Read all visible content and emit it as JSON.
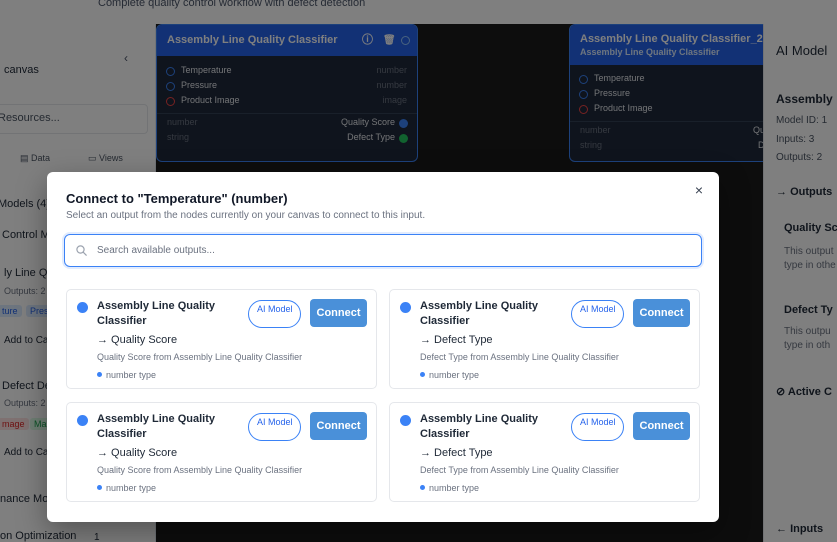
{
  "header": {
    "subtitle": "Complete quality control workflow with defect detection"
  },
  "sidebar": {
    "canvas_label": "canvas",
    "resources_placeholder": "Resources...",
    "tabs": [
      "Data",
      "Views"
    ],
    "section_models": "Models (4)",
    "items": [
      {
        "title": "Control M"
      },
      {
        "title": "ly Line Qu",
        "meta": "Outputs: 2",
        "tags": [
          "ture",
          "Pres"
        ],
        "add": "Add to Ca"
      },
      {
        "title": "Defect De",
        "meta": "Outputs: 2",
        "tags": [
          "mage",
          "Ma"
        ],
        "add": "Add to Ca"
      },
      {
        "title": "nance Mo"
      },
      {
        "title": "on Optimization",
        "count": "1"
      }
    ]
  },
  "nodes": [
    {
      "title": "Assembly Line Quality Classifier",
      "inputs": [
        {
          "label": "Temperature",
          "type": "number"
        },
        {
          "label": "Pressure",
          "type": "number"
        },
        {
          "label": "Product Image",
          "type": "image"
        }
      ],
      "outputs": [
        {
          "type": "number",
          "label": "Quality Score",
          "color": "#3b82f6"
        },
        {
          "type": "string",
          "label": "Defect Type",
          "color": "#22c55e"
        }
      ]
    },
    {
      "title": "Assembly Line Quality Classifier_2",
      "subtitle": "Assembly Line Quality Classifier",
      "inputs": [
        {
          "label": "Temperature"
        },
        {
          "label": "Pressure"
        },
        {
          "label": "Product Image"
        }
      ],
      "outputs": [
        {
          "type": "number",
          "label": "Qu"
        },
        {
          "type": "string",
          "label": "D"
        }
      ]
    }
  ],
  "right_panel": {
    "title": "AI Model",
    "name": "Assembly",
    "model_id": "Model ID: 1",
    "inputs": "Inputs: 3",
    "outputs": "Outputs: 2",
    "outputs_section": "Outputs",
    "out1_title": "Quality Sc",
    "out1_desc1": "This output",
    "out1_desc2": "type in othe",
    "out2_title": "Defect Ty",
    "out2_desc1": "This outpu",
    "out2_desc2": "type in oth",
    "active_section": "Active C",
    "inputs_section": "Inputs"
  },
  "modal": {
    "title": "Connect to \"Temperature\" (number)",
    "description": "Select an output from the nodes currently on your canvas to connect to this input.",
    "close": "×",
    "search_placeholder": "Search available outputs...",
    "cards": [
      {
        "node": "Assembly Line Quality Classifier",
        "badge": "AI Model",
        "button": "Connect",
        "output": "→ Quality Score",
        "desc": "Quality Score from Assembly Line Quality Classifier",
        "type": "number type"
      },
      {
        "node": "Assembly Line Quality Classifier",
        "badge": "AI Model",
        "button": "Connect",
        "output": "→ Defect Type",
        "desc": "Defect Type from Assembly Line Quality Classifier",
        "type": "number type"
      },
      {
        "node": "Assembly Line Quality Classifier",
        "badge": "AI Model",
        "button": "Connect",
        "output": "→ Quality Score",
        "desc": "Quality Score from Assembly Line Quality Classifier",
        "type": "number type"
      },
      {
        "node": "Assembly Line Quality Classifier",
        "badge": "AI Model",
        "button": "Connect",
        "output": "→ Defect Type",
        "desc": "Defect Type from Assembly Line Quality Classifier",
        "type": "number type"
      }
    ]
  }
}
